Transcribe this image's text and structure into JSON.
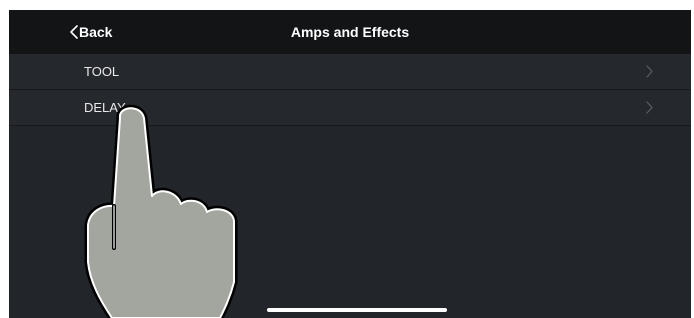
{
  "navbar": {
    "back_label": "Back",
    "title": "Amps and Effects"
  },
  "list": {
    "items": [
      {
        "label": "TOOL"
      },
      {
        "label": "DELAY"
      }
    ]
  },
  "icons": {
    "back": "chevron-left-icon",
    "row_disclosure": "chevron-right-icon",
    "overlay": "pointing-hand-icon"
  },
  "colors": {
    "background": "#22252a",
    "navbar": "#131416",
    "text": "#ffffff",
    "chevron": "#5a5e66",
    "hand_fill": "#a3a59f"
  }
}
